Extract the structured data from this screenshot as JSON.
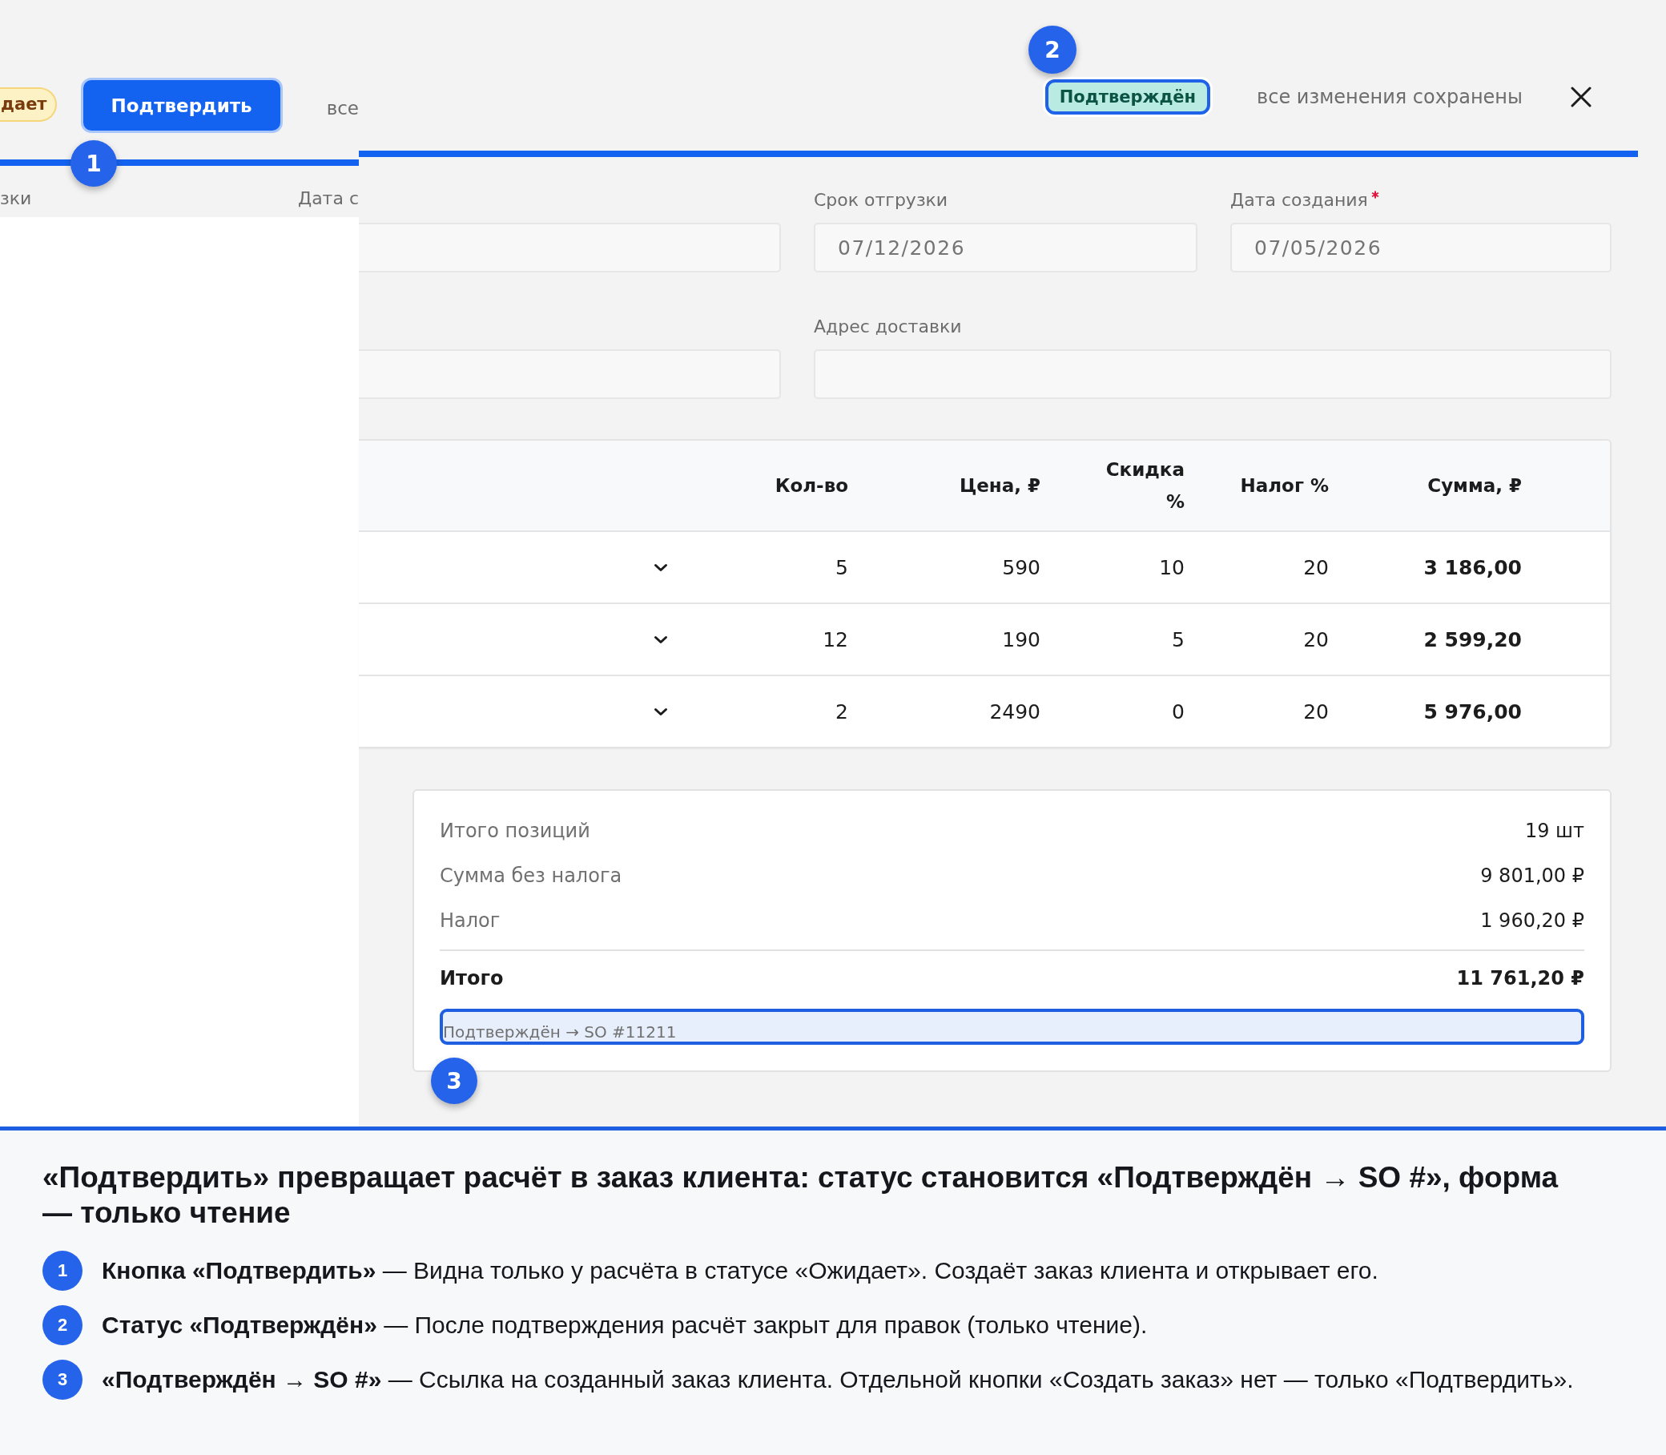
{
  "left_panel": {
    "status_badge": "дает",
    "confirm_button": "Подтвердить",
    "save_status": "все",
    "callout": "1",
    "field_labels": [
      "зки",
      "Дата с"
    ]
  },
  "header": {
    "status_badge": "Подтверждён",
    "save_status": "все изменения сохранены",
    "callout": "2"
  },
  "form": {
    "rows": [
      {
        "fields": [
          {
            "kind": "partial"
          },
          {
            "kind": "input",
            "label": "Срок отгрузки",
            "value": "07/12/2026",
            "required": false
          },
          {
            "kind": "input",
            "label": "Дата создания",
            "value": "07/05/2026",
            "required": true
          }
        ]
      },
      {
        "fields": [
          {
            "kind": "partial"
          },
          {
            "kind": "input",
            "label": "Адрес доставки",
            "required": false
          }
        ]
      }
    ]
  },
  "table": {
    "columns": [
      "Кол-во",
      "Цена, ₽",
      "Скидка %",
      "Налог %",
      "Сумма, ₽"
    ],
    "rows": [
      {
        "cells": [
          "5",
          "590",
          "10",
          "20",
          "3 186,00"
        ]
      },
      {
        "cells": [
          "12",
          "190",
          "5",
          "20",
          "2 599,20"
        ]
      },
      {
        "cells": [
          "2",
          "2490",
          "0",
          "20",
          "5 976,00"
        ]
      }
    ]
  },
  "summary": {
    "rows": [
      {
        "label": "Итого позиций",
        "value": "19 шт"
      },
      {
        "label": "Сумма без налога",
        "value": "9 801,00 ₽"
      },
      {
        "label": "Налог",
        "value": "1 960,20 ₽"
      }
    ],
    "total": {
      "label": "Итого",
      "value": "11 761,20 ₽"
    },
    "link": "Подтверждён → SO #11211",
    "callout": "3"
  },
  "legend": {
    "title": "«Подтвердить» превращает расчёт в заказ клиента: статус становится «Подтверждён → SO #», форма — только чтение",
    "items": [
      {
        "number": "1",
        "text": "**Кнопка «Подтвердить»** — Видна только у расчёта в статусе «Ожидает». Создаёт заказ клиента и открывает его."
      },
      {
        "number": "2",
        "text": "**Статус «Подтверждён»** — После подтверждения расчёт закрыт для правок (только чтение)."
      },
      {
        "number": "3",
        "text": "**«Подтверждён → SO #»** — Ссылка на созданный заказ клиента. Отдельной кнопки «Создать заказ» нет — только «Подтвердить»."
      }
    ]
  }
}
